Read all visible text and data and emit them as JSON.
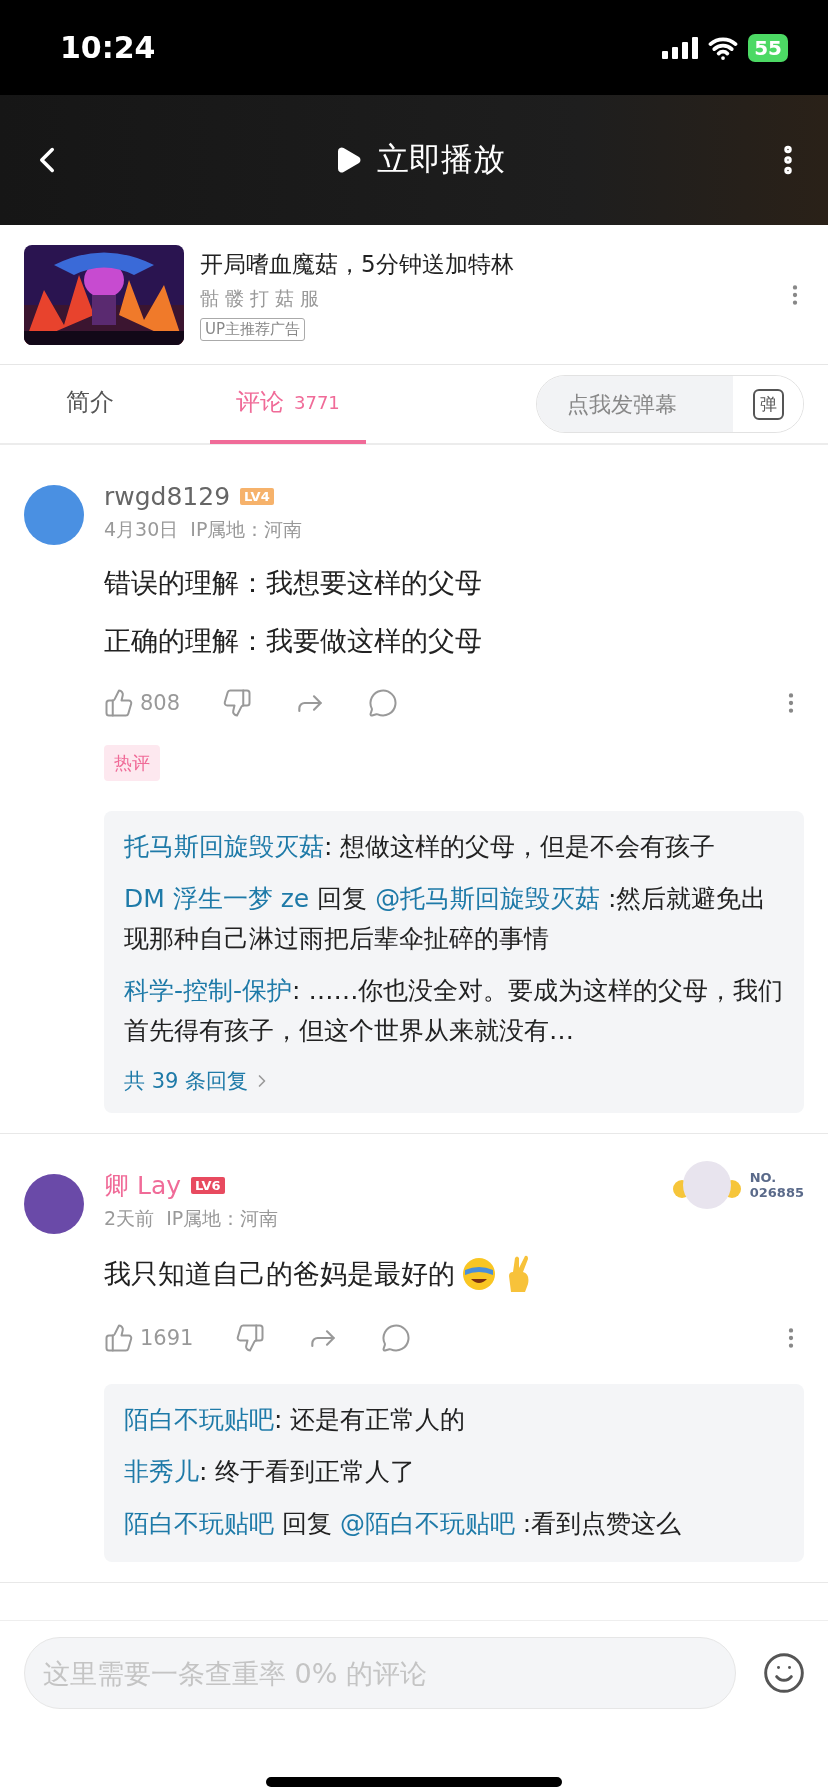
{
  "status_bar": {
    "time": "10:24",
    "battery": "55"
  },
  "header": {
    "play_label": "立即播放"
  },
  "ad": {
    "kind": "picture",
    "title": "开局嗜血魔菇，5分钟送加特林",
    "uploader": "骷 髅 打 菇 服",
    "tag": "UP主推荐广告"
  },
  "tabs": [
    {
      "label": "简介",
      "selected": false
    },
    {
      "label": "评论",
      "count": "3771",
      "selected": true
    }
  ],
  "danmaku": {
    "placeholder": "点我发弹幕",
    "toggle_label": "弹"
  },
  "comments": [
    {
      "user": "rwgd8129",
      "vip": false,
      "level": "LV4",
      "color": "#f6b26b",
      "meta": "4月30日  IP属地：河南",
      "lines": [
        "错误的理解：我想要这样的父母",
        "正确的理解：我要做这样的父母"
      ],
      "stickers": false,
      "likes": "808",
      "tag": "热评",
      "pendant": false,
      "replies": [
        {
          "author": "托马斯回旋毁灭菇",
          "text": ": 想做这样的父母，但是不会有孩子"
        },
        {
          "author": "DM 浮生一梦 ze",
          "reply_word": " 回复 ",
          "reply_to": "@托马斯回旋毁灭菇",
          "text": " :然后就避免出现那种自己淋过雨把后辈伞扯碎的事情"
        },
        {
          "author": "科学-控制-保护",
          "text": ": ……你也没全对。要成为这样的父母，我们首先得有孩子，但这个世界从来就没有…"
        }
      ],
      "more_replies": "共 39 条回复"
    },
    {
      "user": "卿 Lay",
      "vip": true,
      "level": "LV6",
      "color": "#e84a5f",
      "meta": "2天前  IP属地：河南",
      "lines": [
        "我只知道自己的爸妈是最好的"
      ],
      "stickers": true,
      "likes": "1691",
      "pendant": true,
      "pendant_label": "NO.",
      "pendant_number": "026885",
      "replies": [
        {
          "author": "陌白不玩贴吧",
          "text": ": 还是有正常人的"
        },
        {
          "author": "非秀儿",
          "text": ": 终于看到正常人了"
        },
        {
          "author": "陌白不玩贴吧",
          "reply_word": " 回复 ",
          "reply_to": "@陌白不玩贴吧",
          "text": " :看到点赞这么"
        }
      ]
    }
  ],
  "composer": {
    "placeholder": "这里需要一条查重率 0% 的评论"
  }
}
